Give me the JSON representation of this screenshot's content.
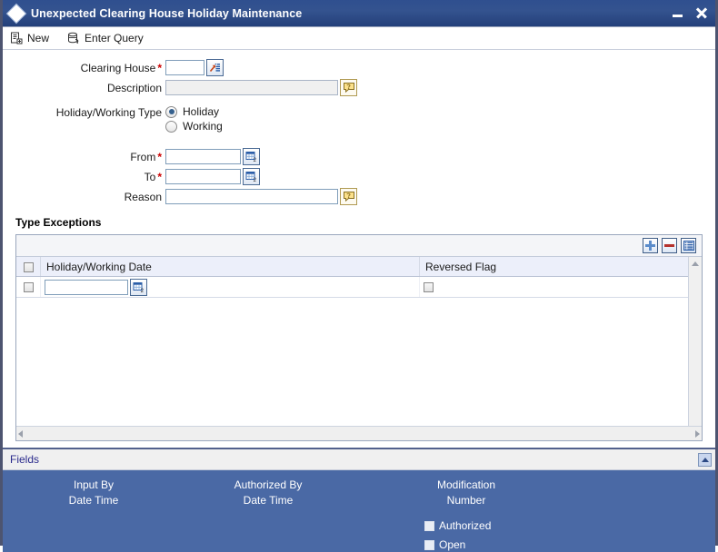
{
  "window": {
    "title": "Unexpected Clearing House Holiday Maintenance",
    "logo_icon": "diamond-icon",
    "minimize_icon": "minimize-icon",
    "close_icon": "close-icon"
  },
  "toolbar": {
    "items": [
      {
        "label": "New",
        "icon": "new-document-icon"
      },
      {
        "label": "Enter Query",
        "icon": "database-query-icon"
      }
    ]
  },
  "form": {
    "clearing_house": {
      "label": "Clearing House",
      "required": "*",
      "value": "",
      "placeholder": "",
      "button_icon": "list-of-values-icon"
    },
    "description": {
      "label": "Description",
      "value": "",
      "placeholder": "",
      "button_icon": "comment-bubble-icon"
    },
    "holiday_working_type": {
      "label": "Holiday/Working Type",
      "options": [
        {
          "label": "Holiday",
          "selected": true
        },
        {
          "label": "Working",
          "selected": false
        }
      ]
    },
    "from": {
      "label": "From",
      "required": "*",
      "value": "",
      "placeholder": "",
      "button_icon": "calendar-icon"
    },
    "to": {
      "label": "To",
      "required": "*",
      "value": "",
      "placeholder": "",
      "button_icon": "calendar-icon"
    },
    "reason": {
      "label": "Reason",
      "value": "",
      "placeholder": "",
      "button_icon": "comment-bubble-icon"
    }
  },
  "type_exceptions": {
    "title": "Type Exceptions",
    "toolbar": {
      "add_icon": "plus-icon",
      "remove_icon": "minus-icon",
      "view_icon": "grid-view-icon"
    },
    "columns": [
      "Holiday/Working Date",
      "Reversed Flag"
    ],
    "rows": [
      {
        "selected": false,
        "holiday_working_date": "",
        "date_button_icon": "calendar-icon",
        "reversed_flag": false
      }
    ],
    "vscroll_up_icon": "scroll-up-arrow-icon",
    "hscroll_left_icon": "scroll-left-arrow-icon",
    "hscroll_right_icon": "scroll-right-arrow-icon"
  },
  "fields_bar": {
    "label": "Fields",
    "collapse_icon": "collapse-up-icon"
  },
  "footer": {
    "input_by_label": "Input By",
    "input_by_datetime_label": "Date Time",
    "authorized_by_label": "Authorized By",
    "authorized_by_datetime_label": "Date Time",
    "modification_label": "Modification",
    "number_label": "Number",
    "authorized_checkbox_label": "Authorized",
    "open_checkbox_label": "Open"
  },
  "colors": {
    "titlebar_blue": "#2f4f8f",
    "footer_blue": "#4a69a5",
    "required_red": "#cc0000",
    "link_navy": "#2a2a8c",
    "grid_header": "#eceffa",
    "window_border": "#4d5470"
  }
}
